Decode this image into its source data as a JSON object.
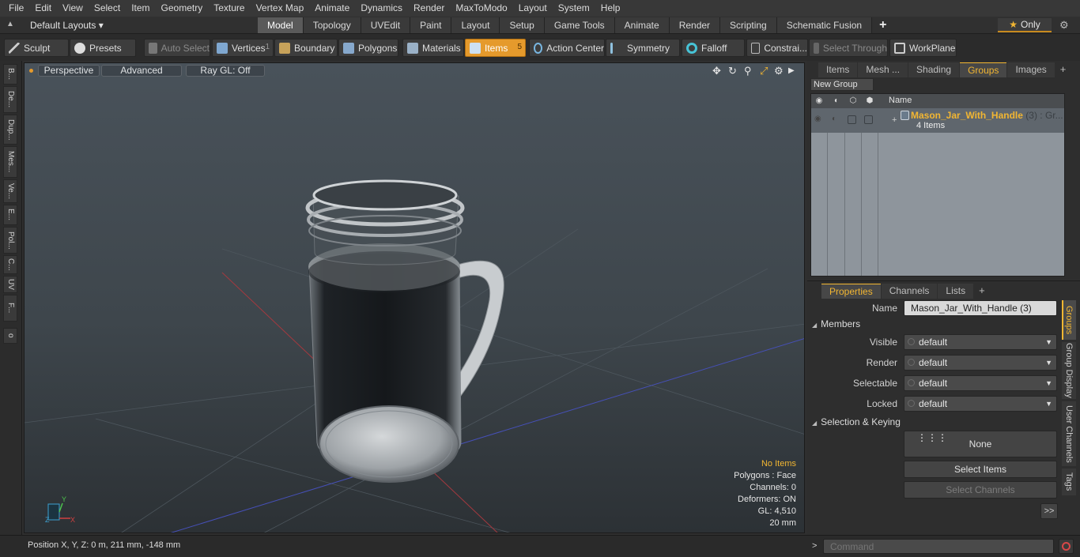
{
  "menubar": {
    "items": [
      "File",
      "Edit",
      "View",
      "Select",
      "Item",
      "Geometry",
      "Texture",
      "Vertex Map",
      "Animate",
      "Dynamics",
      "Render",
      "MaxToModo",
      "Layout",
      "System",
      "Help"
    ]
  },
  "layoutbar": {
    "layout_select": "Default Layouts ▾",
    "tabs": [
      "Model",
      "Topology",
      "UVEdit",
      "Paint",
      "Layout",
      "Setup",
      "Game Tools",
      "Animate",
      "Render",
      "Scripting",
      "Schematic Fusion"
    ],
    "active_tab": "Model",
    "only_label": "Only"
  },
  "toolbar": {
    "sculpt": "Sculpt",
    "presets": "Presets",
    "auto_select": "Auto Select",
    "vertices": "Vertices",
    "vertices_count": "1",
    "boundary": "Boundary",
    "polygons": "Polygons",
    "materials": "Materials",
    "items": "Items",
    "items_count": "5",
    "action_center": "Action Center",
    "symmetry": "Symmetry",
    "falloff": "Falloff",
    "constraints": "Constrai...",
    "select_through": "Select Through",
    "workplane": "WorkPlane"
  },
  "leftstrip": {
    "tabs": [
      "B...",
      "De...",
      "Dup...",
      "Mes...",
      "Ve...",
      "E...",
      "Pol...",
      "C...",
      "UV",
      "F...",
      "o"
    ]
  },
  "viewport": {
    "projection": "Perspective",
    "shading": "Advanced",
    "raygl": "Ray GL: Off",
    "info": {
      "no_items": "No Items",
      "polygons": "Polygons : Face",
      "channels": "Channels: 0",
      "deformers": "Deformers: ON",
      "gl": "GL: 4,510",
      "unit": "20 mm"
    },
    "axes": {
      "x": "X",
      "y": "Y",
      "z": "Z"
    }
  },
  "groups_panel": {
    "tabs": [
      "Items",
      "Mesh ...",
      "Shading",
      "Groups",
      "Images"
    ],
    "active_tab": "Groups",
    "new_group": "New Group",
    "name_header": "Name",
    "row": {
      "name": "Mason_Jar_With_Handle",
      "suffix": "(3) : Gr...",
      "count": "4 Items"
    }
  },
  "properties": {
    "tabs": [
      "Properties",
      "Channels",
      "Lists"
    ],
    "active_tab": "Properties",
    "name_label": "Name",
    "name_value": "Mason_Jar_With_Handle (3)",
    "members_section": "Members",
    "visible_label": "Visible",
    "visible_value": "default",
    "render_label": "Render",
    "render_value": "default",
    "selectable_label": "Selectable",
    "selectable_value": "default",
    "locked_label": "Locked",
    "locked_value": "default",
    "selection_section": "Selection & Keying",
    "none_button": "None",
    "select_items": "Select Items",
    "select_channels": "Select Channels",
    "more": ">>",
    "side_tabs": [
      "Groups",
      "Group Display",
      "User Channels",
      "Tags"
    ]
  },
  "statusbar": {
    "position": "Position X, Y, Z:   0 m, 211 mm, -148 mm"
  },
  "command": {
    "placeholder": "Command"
  }
}
